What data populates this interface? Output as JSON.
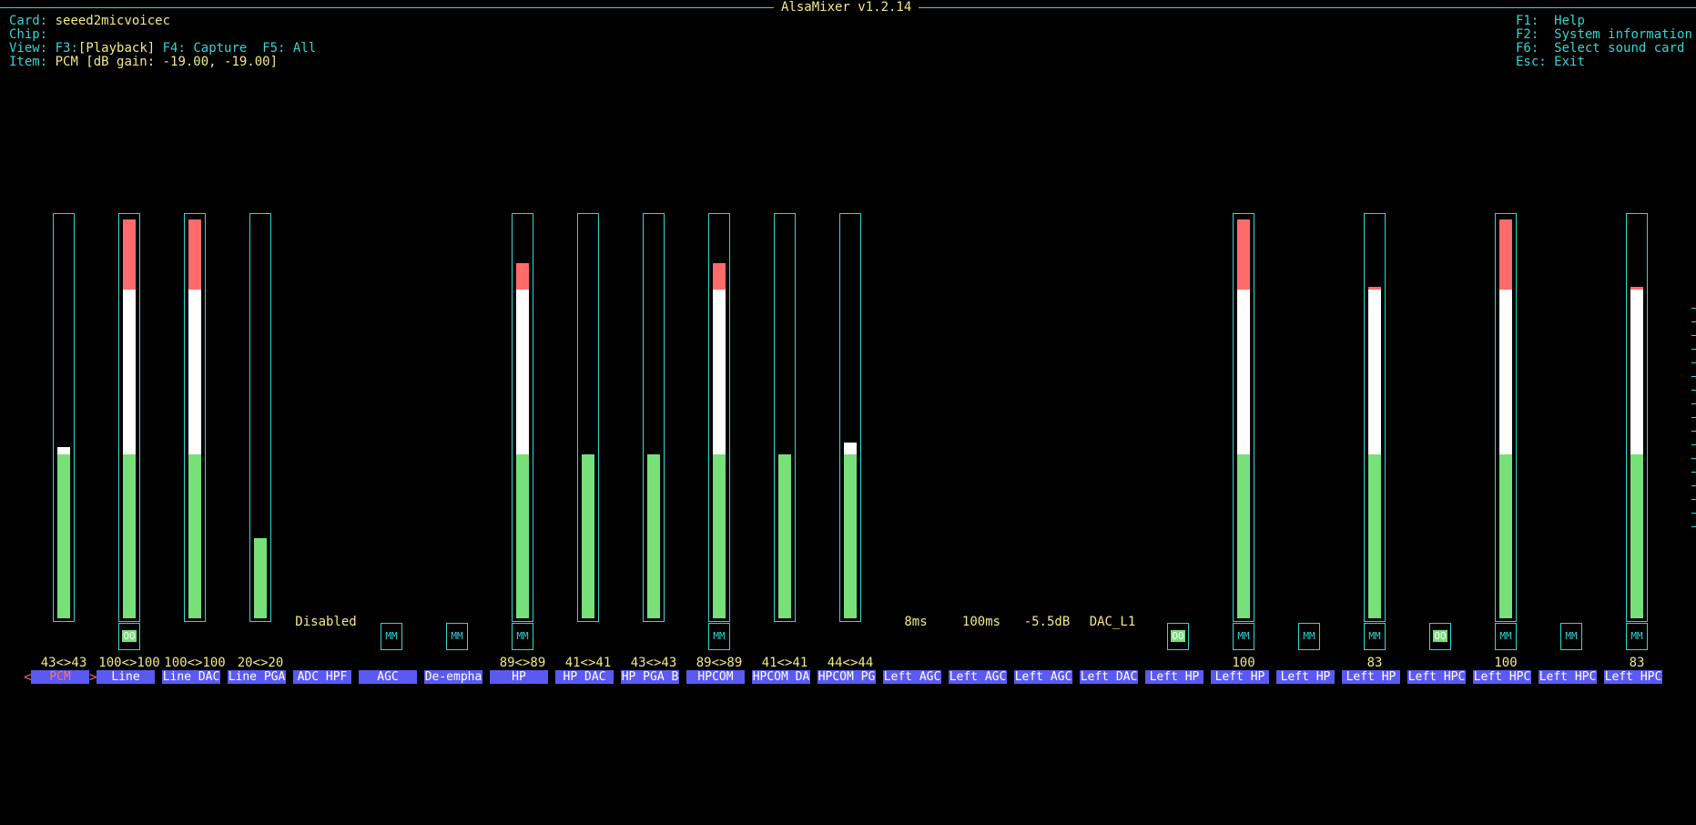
{
  "title": "AlsaMixer v1.2.14",
  "info": {
    "card_label": "Card:",
    "card_value": "seeed2micvoicec",
    "chip_label": "Chip:",
    "view_label": "View:",
    "view_f3": "F3:",
    "view_playback": "[Playback]",
    "view_rest": " F4: Capture  F5: All",
    "item_label": "Item:",
    "item_value": "PCM [dB gain: -19.00, -19.00]"
  },
  "help": [
    {
      "key": "F1:",
      "text": "Help"
    },
    {
      "key": "F2:",
      "text": "System information"
    },
    {
      "key": "F6:",
      "text": "Select sound card"
    },
    {
      "key": "Esc:",
      "text": "Exit"
    }
  ],
  "nav": {
    "left": "<",
    "right": ">"
  },
  "controls": [
    {
      "label": "PCM",
      "value": "43<>43",
      "level": 43,
      "selected": true
    },
    {
      "label": "Line",
      "value": "100<>100",
      "level": 100,
      "switch": "OO",
      "switch_on": true
    },
    {
      "label": "Line DAC",
      "value": "100<>100",
      "level": 100
    },
    {
      "label": "Line PGA",
      "value": "20<>20",
      "level": 20
    },
    {
      "label": "ADC HPF",
      "text": "Disabled"
    },
    {
      "label": "AGC",
      "switch": "MM",
      "switch_on": false
    },
    {
      "label": "De-empha",
      "switch": "MM",
      "switch_on": false
    },
    {
      "label": "HP",
      "value": "89<>89",
      "level": 89,
      "switch": "MM",
      "switch_on": false
    },
    {
      "label": "HP DAC",
      "value": "41<>41",
      "level": 41
    },
    {
      "label": "HP PGA B",
      "value": "43<>43",
      "level": 41
    },
    {
      "label": "HPCOM",
      "value": "89<>89",
      "level": 89,
      "switch": "MM",
      "switch_on": false
    },
    {
      "label": "HPCOM DA",
      "value": "41<>41",
      "level": 41
    },
    {
      "label": "HPCOM PG",
      "value": "44<>44",
      "level": 44
    },
    {
      "label": "Left AGC",
      "text": "8ms"
    },
    {
      "label": "Left AGC",
      "text": "100ms"
    },
    {
      "label": "Left AGC",
      "text": "-5.5dB"
    },
    {
      "label": "Left DAC",
      "text": "DAC_L1"
    },
    {
      "label": "Left HP",
      "switch": "OO",
      "switch_on": true
    },
    {
      "label": "Left HP",
      "value": "100",
      "level": 100,
      "switch": "MM",
      "switch_on": false
    },
    {
      "label": "Left HP",
      "switch": "MM",
      "switch_on": false
    },
    {
      "label": "Left HP",
      "value": "83",
      "level": 83,
      "switch": "MM",
      "switch_on": false
    },
    {
      "label": "Left HPC",
      "switch": "OO",
      "switch_on": true
    },
    {
      "label": "Left HPC",
      "value": "100",
      "level": 100,
      "switch": "MM",
      "switch_on": false
    },
    {
      "label": "Left HPC",
      "switch": "MM",
      "switch_on": false
    },
    {
      "label": "Left HPC",
      "value": "83",
      "level": 83,
      "switch": "MM",
      "switch_on": false
    }
  ],
  "colors": {
    "accent": "#33d6d6",
    "text": "#f2ea82",
    "label_bg": "#5a5af2",
    "selected": "#ff7070",
    "green": "#78e078",
    "white": "#ffffff",
    "red": "#ff6b6b"
  }
}
